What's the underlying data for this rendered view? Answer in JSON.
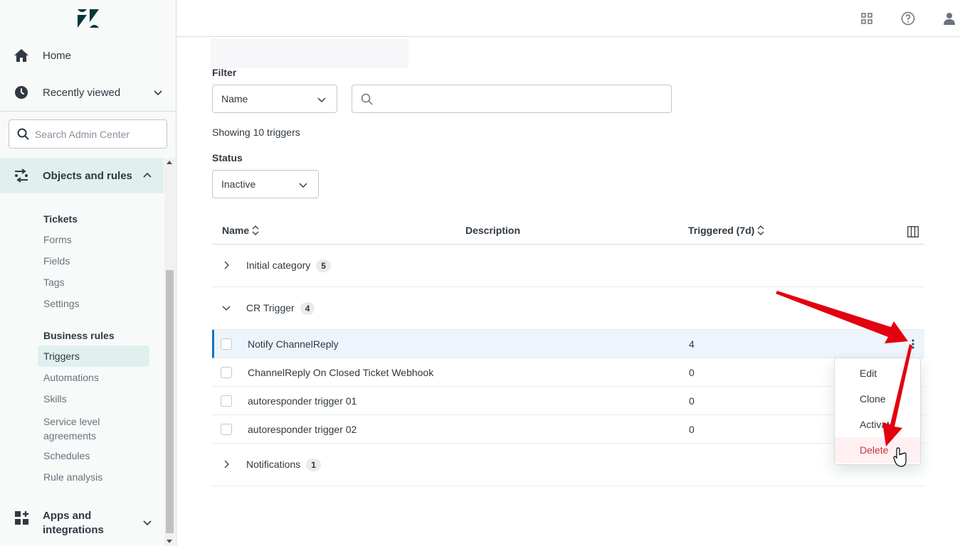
{
  "sidebar": {
    "logo": "zendesk-logo",
    "nav": [
      {
        "label": "Home",
        "icon": "home-icon"
      },
      {
        "label": "Recently viewed",
        "icon": "clock-icon"
      }
    ],
    "search_placeholder": "Search Admin Center",
    "objects_header": "Objects and rules",
    "tickets_title": "Tickets",
    "tickets_items": [
      "Forms",
      "Fields",
      "Tags",
      "Settings"
    ],
    "business_title": "Business rules",
    "business_active": "Triggers",
    "business_items": [
      "Automations",
      "Skills",
      "Service level agreements",
      "Schedules",
      "Rule analysis"
    ],
    "apps_label": "Apps and integrations"
  },
  "header": {
    "icons": [
      "apps-grid-icon",
      "help-icon",
      "user-icon"
    ]
  },
  "main": {
    "filter_label": "Filter",
    "filter_select": "Name",
    "search_value": "",
    "showing": "Showing 10 triggers",
    "status_label": "Status",
    "status_select": "Inactive",
    "columns": {
      "name": "Name",
      "description": "Description",
      "triggered": "Triggered (7d)"
    },
    "groups": [
      {
        "name": "Initial category",
        "count": "5"
      },
      {
        "name": "CR Trigger",
        "count": "4"
      },
      {
        "name": "Notifications",
        "count": "1"
      }
    ],
    "rows": [
      {
        "name": "Notify ChannelReply",
        "triggered": "4"
      },
      {
        "name": "ChannelReply On Closed Ticket Webhook",
        "triggered": "0"
      },
      {
        "name": "autoresponder trigger 01",
        "triggered": "0"
      },
      {
        "name": "autoresponder trigger 02",
        "triggered": "0"
      }
    ]
  },
  "menu": {
    "items": [
      "Edit",
      "Clone",
      "Activate",
      "Delete"
    ]
  },
  "colors": {
    "accent": "#1f73b7",
    "active_bg": "#dff0ef",
    "danger": "#cc3340",
    "arrow": "#e3000f"
  }
}
